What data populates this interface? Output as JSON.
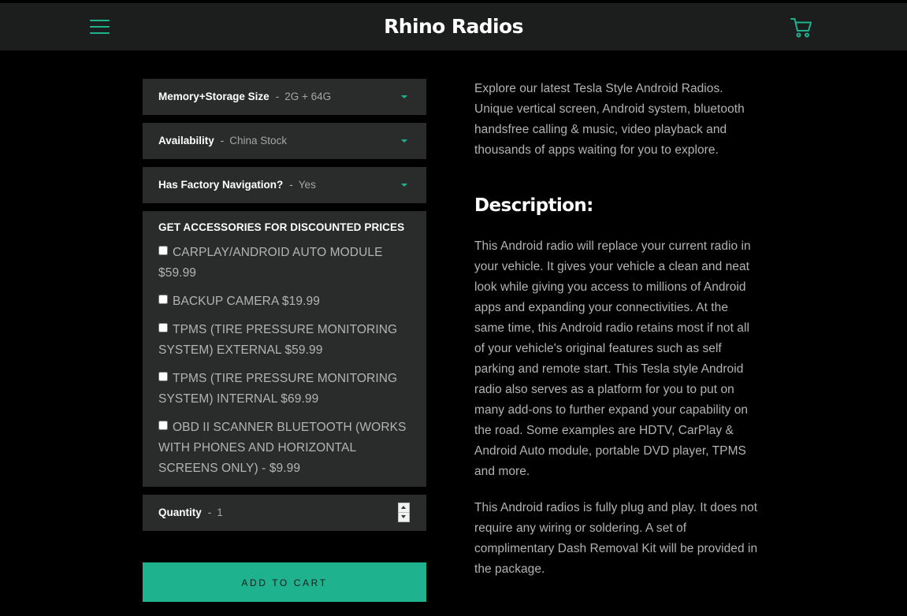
{
  "header": {
    "site_title": "Rhino Radios",
    "menu_icon": "hamburger-menu-icon",
    "cart_icon": "shopping-cart-icon",
    "accent_color": "#1fb28f",
    "bar_color": "#1c1d1d"
  },
  "options": [
    {
      "label": "Memory+Storage Size",
      "separator": "-",
      "value": "2G + 64G"
    },
    {
      "label": "Availability",
      "separator": "-",
      "value": "China Stock"
    },
    {
      "label": "Has Factory Navigation?",
      "separator": "-",
      "value": "Yes"
    }
  ],
  "accessories": {
    "title": "GET ACCESSORIES FOR DISCOUNTED PRICES",
    "items": [
      {
        "label": "CARPLAY/ANDROID AUTO MODULE $59.99",
        "checked": false
      },
      {
        "label": "BACKUP CAMERA $19.99",
        "checked": false
      },
      {
        "label": "TPMS (TIRE PRESSURE MONITORING SYSTEM) EXTERNAL $59.99",
        "checked": false
      },
      {
        "label": "TPMS (TIRE PRESSURE MONITORING SYSTEM) INTERNAL $69.99",
        "checked": false
      },
      {
        "label": "OBD II SCANNER BLUETOOTH (WORKS WITH PHONES AND HORIZONTAL SCREENS ONLY) - $9.99",
        "checked": false
      }
    ]
  },
  "quantity": {
    "label": "Quantity",
    "separator": "-",
    "value": "1"
  },
  "add_to_cart_label": "ADD TO CART",
  "content": {
    "intro": "Explore our latest Tesla Style Android Radios. Unique vertical screen, Android system, bluetooth handsfree calling & music, video playback and thousands of apps waiting for you to explore.",
    "description_heading": "Description:",
    "paragraph_1": "This Android radio will replace your current radio in your vehicle. It gives your vehicle a clean and neat look while giving you access to millions of Android apps and expanding your connectivities. At the same time, this Android radio retains most if not all of your vehicle's original features such as self parking and remote start. This Tesla style Android radio also serves as a platform for you to put on many add-ons to further expand your capability on the road. Some examples are HDTV, CarPlay & Android Auto module, portable DVD player, TPMS and more.",
    "paragraph_2": "This Android radios is fully plug and play. It does not require any wiring or soldering. A set of complimentary Dash Removal Kit will be provided in the package."
  }
}
